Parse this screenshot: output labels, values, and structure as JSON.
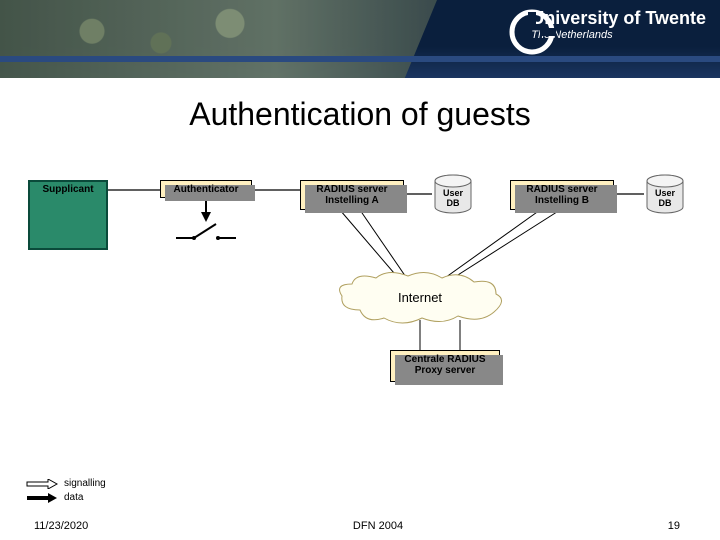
{
  "header": {
    "university": "University of Twente",
    "subtitle": "The Netherlands"
  },
  "title": "Authentication of guests",
  "diagram": {
    "supplicant": "Supplicant",
    "authenticator": "Authenticator",
    "radiusA_line1": "RADIUS server",
    "radiusA_line2": "Instelling A",
    "radiusB_line1": "RADIUS server",
    "radiusB_line2": "Instelling B",
    "userdb": "User\nDB",
    "internet": "Internet",
    "proxy_line1": "Centrale RADIUS",
    "proxy_line2": "Proxy server"
  },
  "legend": {
    "signalling": "signalling",
    "data": "data"
  },
  "footer": {
    "date": "11/23/2020",
    "center": "DFN 2004",
    "page": "19"
  }
}
